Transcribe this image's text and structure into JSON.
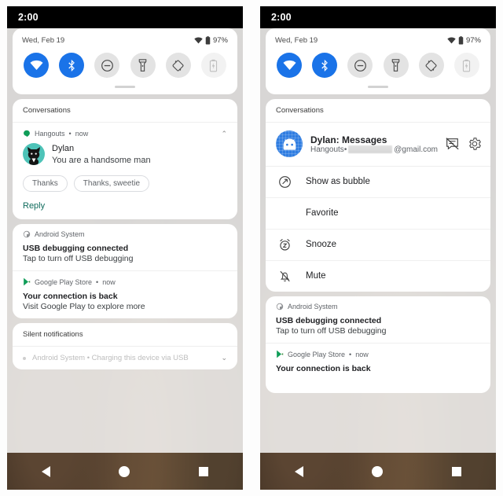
{
  "status_bar": {
    "clock": "2:00"
  },
  "quick_settings": {
    "date": "Wed, Feb 19",
    "battery_percent": "97%",
    "wifi_icon": "wifi-icon",
    "battery_icon": "battery-icon",
    "tiles": [
      {
        "name": "wifi-tile",
        "icon": "wifi-icon",
        "state": "on"
      },
      {
        "name": "bluetooth-tile",
        "icon": "bluetooth-icon",
        "state": "on"
      },
      {
        "name": "do-not-disturb-tile",
        "icon": "do-not-disturb-icon",
        "state": "off"
      },
      {
        "name": "flashlight-tile",
        "icon": "flashlight-icon",
        "state": "off"
      },
      {
        "name": "auto-rotate-tile",
        "icon": "auto-rotate-icon",
        "state": "off"
      },
      {
        "name": "battery-saver-tile",
        "icon": "battery-saver-icon",
        "state": "disabled"
      }
    ]
  },
  "left_panel": {
    "conversations_header": "Conversations",
    "conversation": {
      "app_name": "Hangouts",
      "separator": "•",
      "time": "now",
      "collapse_icon": "chevron-up-icon",
      "sender": "Dylan",
      "message": "You are a handsome man",
      "avatar": "cat-avatar",
      "smart_replies": [
        "Thanks",
        "Thanks, sweetie"
      ],
      "reply_label": "Reply",
      "reply_color": "#0f6b5c"
    },
    "notifications": [
      {
        "app_name": "Android System",
        "app_icon": "android-system-icon",
        "title": "USB debugging connected",
        "subtitle": "Tap to turn off USB debugging"
      },
      {
        "app_name": "Google Play Store",
        "app_icon": "google-play-icon",
        "separator": "•",
        "time": "now",
        "title": "Your connection is back",
        "subtitle": "Visit Google Play to explore more"
      }
    ],
    "silent_header": "Silent notifications",
    "silent_row": {
      "text": "Android System • Charging this device via USB",
      "expand_icon": "chevron-down-icon"
    }
  },
  "right_panel": {
    "conversations_header": "Conversations",
    "conversation_menu": {
      "title": "Dylan: Messages",
      "subtitle_app": "Hangouts",
      "subtitle_separator": "•",
      "subtitle_email_suffix": "@gmail.com",
      "subtitle_email_redacted": true,
      "avatar": "android-avatar",
      "silence_icon": "conversation-off-icon",
      "settings_icon": "gear-icon",
      "items": [
        {
          "label": "Show as bubble",
          "icon": "bubble-icon"
        },
        {
          "label": "Favorite",
          "icon": ""
        },
        {
          "label": "Snooze",
          "icon": "snooze-icon"
        },
        {
          "label": "Mute",
          "icon": "mute-bell-icon"
        }
      ]
    },
    "notifications": [
      {
        "app_name": "Android System",
        "app_icon": "android-system-icon",
        "title": "USB debugging connected",
        "subtitle": "Tap to turn off USB debugging"
      },
      {
        "app_name": "Google Play Store",
        "app_icon": "google-play-icon",
        "separator": "•",
        "time": "now",
        "title": "Your connection is back"
      }
    ]
  },
  "nav_bar": {
    "back": "back-triangle-icon",
    "home": "home-circle-icon",
    "recents": "recents-square-icon"
  },
  "colors": {
    "accent_blue": "#1a73e8",
    "reply_green": "#0f6b5c",
    "tile_off": "#e3e3e3"
  }
}
